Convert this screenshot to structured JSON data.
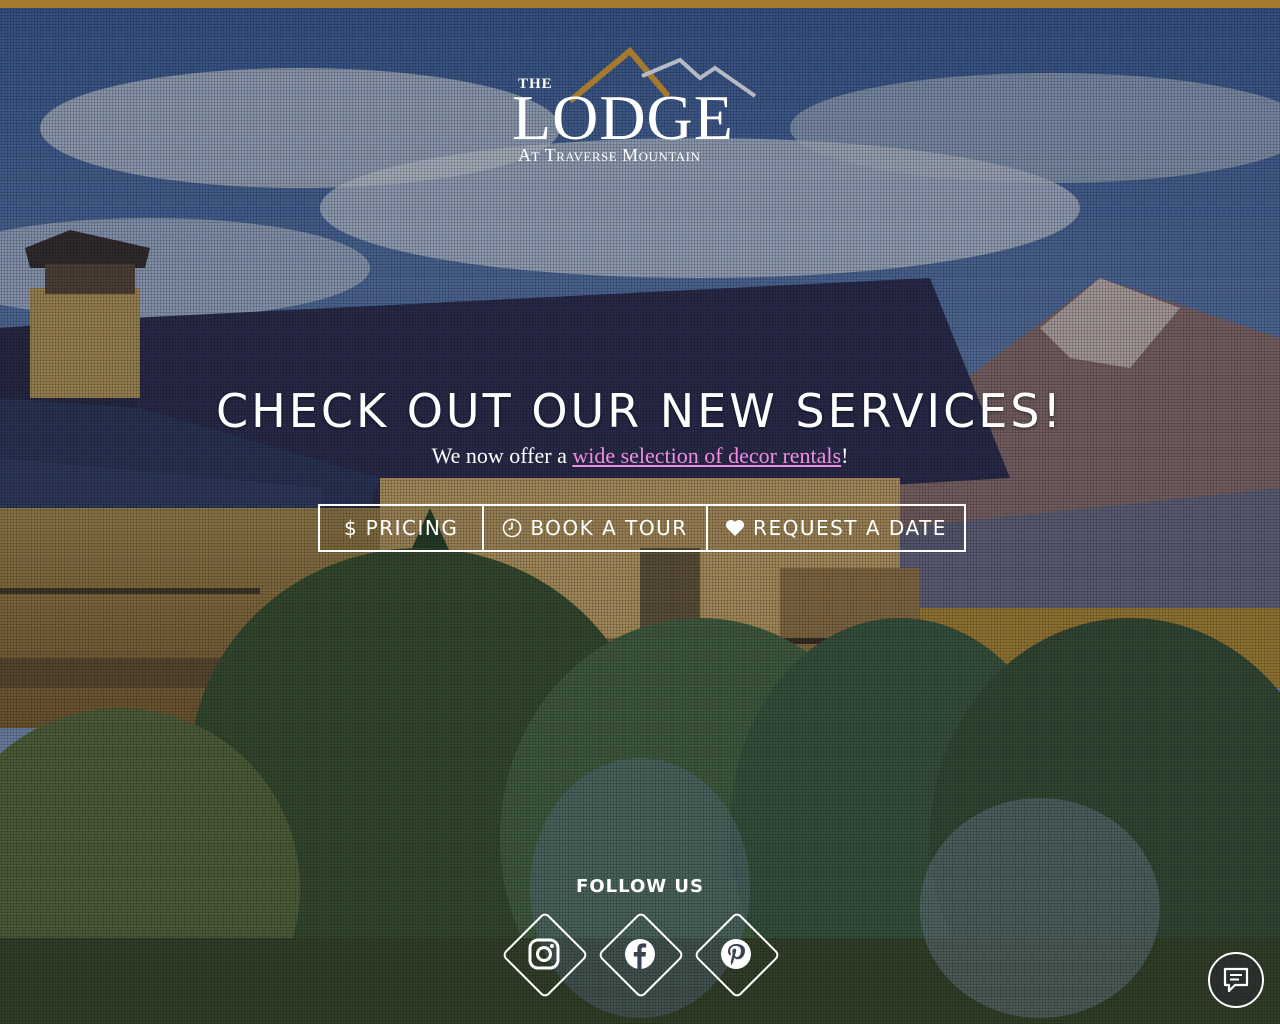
{
  "brand": {
    "line1": "THE",
    "line2": "LODGE",
    "line3": "At Traverse Mountain"
  },
  "hero": {
    "headline": "CHECK OUT OUR NEW SERVICES!",
    "subline_before": "We now offer a ",
    "subline_link": "wide selection of decor rentals",
    "subline_after": "!"
  },
  "buttons": [
    {
      "label": "PRICING",
      "icon": "dollar-icon"
    },
    {
      "label": "BOOK A TOUR",
      "icon": "clock-icon"
    },
    {
      "label": "REQUEST A DATE",
      "icon": "heart-icon"
    }
  ],
  "follow": {
    "title": "FOLLOW US",
    "items": [
      {
        "icon": "instagram-icon"
      },
      {
        "icon": "facebook-icon"
      },
      {
        "icon": "pinterest-icon"
      }
    ]
  },
  "chat": {
    "icon": "chat-icon"
  },
  "colors": {
    "accent": "#a57a2e",
    "link": "#f28ce0",
    "text": "#ffffff"
  }
}
